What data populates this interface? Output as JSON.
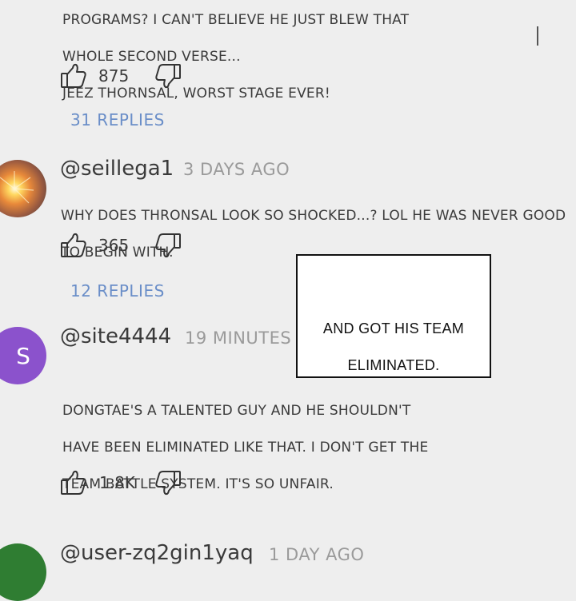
{
  "comments": [
    {
      "text_lines": [
        "PROGRAMS? I CAN'T BELIEVE HE JUST BLEW THAT",
        "WHOLE SECOND VERSE...",
        "JEEZ THORNSAL, WORST STAGE EVER!"
      ],
      "likes": "875",
      "replies": "31 REPLIES"
    },
    {
      "username": "@seillega1",
      "time": "3 DAYS AGO",
      "text_lines": [
        "WHY DOES THRONSAL LOOK SO SHOCKED...? LOL HE WAS NEVER GOOD",
        "TO BEGIN WITH."
      ],
      "likes": "365",
      "replies": "12 REPLIES"
    },
    {
      "username": "@site4444",
      "time": "19 MINUTES AGO",
      "avatar_letter": "S",
      "avatar_color": "#8b52cc",
      "text_lines": [
        "DONGTAE'S A TALENTED GUY AND HE SHOULDN'T",
        "HAVE BEEN ELIMINATED LIKE THAT. I DON'T GET THE",
        "TEAM BATTLE SYSTEM. IT'S SO UNFAIR."
      ],
      "likes": "1.8K"
    },
    {
      "username": "@user-zq2gin1yaq",
      "time": "1 DAY AGO",
      "avatar_color": "#2f7d32"
    }
  ],
  "caption": {
    "lines": [
      "AND GOT HIS TEAM",
      "ELIMINATED."
    ]
  },
  "icons": {
    "like": "thumbs-up-icon",
    "dislike": "thumbs-down-icon"
  }
}
